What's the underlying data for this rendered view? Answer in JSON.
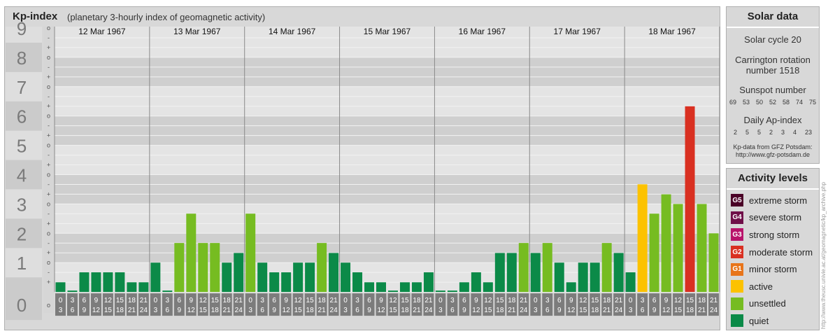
{
  "header": {
    "title": "Kp-index",
    "subtitle": "(planetary 3-hourly index of geomagnetic activity)"
  },
  "chart_data": {
    "type": "bar",
    "title": "Kp-index",
    "ylim": [
      0,
      9
    ],
    "y_major_ticks": [
      "0",
      "1",
      "2",
      "3",
      "4",
      "5",
      "6",
      "7",
      "8",
      "9"
    ],
    "y_minor_ticks": [
      "o",
      "+",
      "-"
    ],
    "days": [
      "12 Mar 1967",
      "13 Mar 1967",
      "14 Mar 1967",
      "15 Mar 1967",
      "16 Mar 1967",
      "17 Mar 1967",
      "18 Mar 1967"
    ],
    "interval_labels": [
      [
        "0",
        "3"
      ],
      [
        "3",
        "6"
      ],
      [
        "6",
        "9"
      ],
      [
        "9",
        "12"
      ],
      [
        "12",
        "15"
      ],
      [
        "15",
        "18"
      ],
      [
        "18",
        "21"
      ],
      [
        "21",
        "24"
      ]
    ],
    "values": [
      [
        0.33,
        0,
        0.67,
        0.67,
        0.67,
        0.67,
        0.33,
        0.33
      ],
      [
        1.0,
        0,
        1.67,
        2.67,
        1.67,
        1.67,
        1.0,
        1.33
      ],
      [
        2.67,
        1.0,
        0.67,
        0.67,
        1.0,
        1.0,
        1.67,
        1.33
      ],
      [
        1.0,
        0.67,
        0.33,
        0.33,
        0,
        0.33,
        0.33,
        0.67
      ],
      [
        0,
        0,
        0.33,
        0.67,
        0.33,
        1.33,
        1.33,
        1.67
      ],
      [
        1.33,
        1.67,
        1.0,
        0.33,
        1.0,
        1.0,
        1.67,
        1.33
      ],
      [
        0.67,
        3.67,
        2.67,
        3.33,
        3.0,
        6.33,
        3.0,
        2.0
      ]
    ],
    "colors": {
      "quiet": "#0b8a48",
      "unsettled": "#76bc21",
      "active": "#fcc200",
      "minor_storm": "#e8751a",
      "moderate_storm": "#d93021",
      "strong_storm": "#b8136a",
      "severe_storm": "#6f0f48",
      "extreme_storm": "#4a0026"
    }
  },
  "solar": {
    "heading": "Solar data",
    "cycle": "Solar cycle 20",
    "carrington_line1": "Carrington rotation",
    "carrington_line2": "number 1518",
    "sunspot_label": "Sunspot number",
    "sunspot_values": [
      "69",
      "53",
      "50",
      "52",
      "58",
      "74",
      "75"
    ],
    "ap_label": "Daily Ap-index",
    "ap_values": [
      "2",
      "5",
      "5",
      "2",
      "3",
      "4",
      "23"
    ],
    "credit_line1": "Kp-data from GFZ Potsdam:",
    "credit_line2": "http://www.gfz-potsdam.de"
  },
  "activity": {
    "heading": "Activity levels",
    "levels": [
      {
        "badge": "G5",
        "label": "extreme storm",
        "color": "#4a0026"
      },
      {
        "badge": "G4",
        "label": "severe storm",
        "color": "#6f0f48"
      },
      {
        "badge": "G3",
        "label": "strong storm",
        "color": "#b8136a"
      },
      {
        "badge": "G2",
        "label": "moderate storm",
        "color": "#d93021"
      },
      {
        "badge": "G1",
        "label": "minor storm",
        "color": "#e8751a"
      },
      {
        "badge": "",
        "label": "active",
        "color": "#fcc200"
      },
      {
        "badge": "",
        "label": "unsettled",
        "color": "#76bc21"
      },
      {
        "badge": "",
        "label": "quiet",
        "color": "#0b8a48"
      }
    ]
  },
  "watermark": "http://www.theusc.univie.ac.at/geomagnetic/kp_archive.php"
}
